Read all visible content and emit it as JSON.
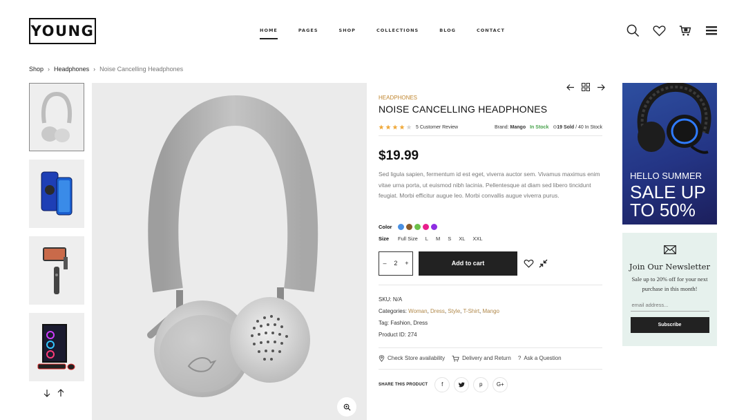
{
  "brand": {
    "logo": "YOUNG"
  },
  "nav": {
    "items": [
      {
        "label": "HOME",
        "active": true
      },
      {
        "label": "PAGES"
      },
      {
        "label": "SHOP"
      },
      {
        "label": "COLLECTIONS"
      },
      {
        "label": "BLOG"
      },
      {
        "label": "CONTACT"
      }
    ]
  },
  "header_icons": [
    "search-icon",
    "heart-icon",
    "cart-icon",
    "menu-icon"
  ],
  "breadcrumb": {
    "items": [
      "Shop",
      "Headphones"
    ],
    "current": "Noise Cancelling Headphones"
  },
  "thumbnails": [
    "headphones",
    "phone-case",
    "gimbal",
    "gaming-pc"
  ],
  "product": {
    "category": "HEADPHONES",
    "title": "NOISE CANCELLING HEADPHONES",
    "rating": 4,
    "rating_max": 5,
    "review_text": "5 Customer Review",
    "brand_label": "Brand:",
    "brand_value": "Mango",
    "stock_status": "In Stock",
    "sold_text": "19 Sold",
    "stock_text": "/ 40 In Stock",
    "price": "$19.99",
    "description": "Sed ligula sapien, fermentum id est eget, viverra auctor sem. Vivamus maximus enim vitae urna porta, ut euismod nibh lacinia. Pellentesque at diam sed libero tincidunt feugiat. Morbi efficitur augue leo. Morbi convallis augue viverra purus.",
    "color_label": "Color",
    "colors": [
      "#4a90e2",
      "#8b5a2b",
      "#6cc04a",
      "#e91e8c",
      "#8e2de2"
    ],
    "size_label": "Size",
    "sizes": [
      "Full Size",
      "L",
      "M",
      "S",
      "XL",
      "XXL"
    ],
    "quantity": "2",
    "qty_minus": "–",
    "qty_plus": "+",
    "add_to_cart": "Add to cart",
    "sku_label": "SKU:",
    "sku_value": "N/A",
    "categories_label": "Categories:",
    "categories": [
      "Woman",
      "Dress",
      "Style",
      "T-Shirt",
      "Mango"
    ],
    "tag_label": "Tag:",
    "tags": "Fashion, Dress",
    "product_id_label": "Product ID:",
    "product_id": "274",
    "actions": [
      "Check Store availability",
      "Delivery and Return",
      "Ask a Question"
    ],
    "share_label": "SHARE THIS PRODUCT",
    "social": [
      "f",
      "t",
      "p",
      "G+"
    ]
  },
  "banner": {
    "line1": "HELLO SUMMER",
    "line2": "SALE UP",
    "line3": "TO 50%"
  },
  "newsletter": {
    "title": "Join Our Newsletter",
    "text": "Sale up to 20% off for your next purchase in this month!",
    "placeholder": "email address...",
    "button": "Subscribe"
  }
}
